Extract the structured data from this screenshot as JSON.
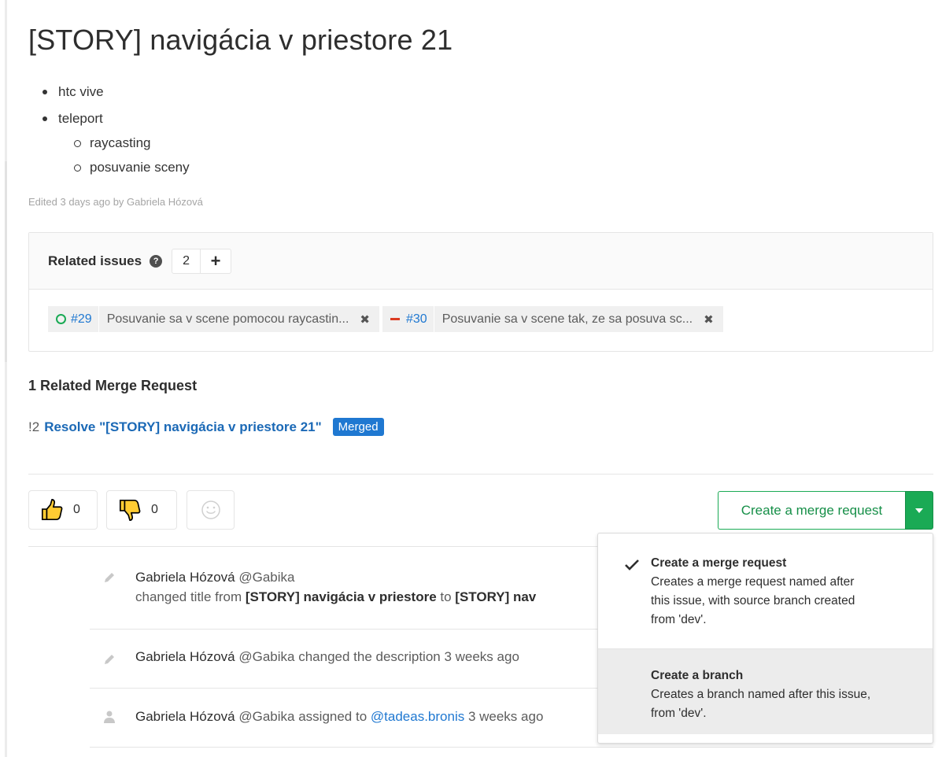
{
  "issue": {
    "title": "[STORY] navigácia v priestore 21",
    "description": {
      "items": [
        "htc vive",
        "teleport"
      ],
      "subitems": [
        "raycasting",
        "posuvanie sceny"
      ]
    },
    "edited_text": "Edited 3 days ago by Gabriela Hózová"
  },
  "related_issues": {
    "title": "Related issues",
    "count": "2",
    "add_label": "+",
    "items": [
      {
        "status": "open",
        "ref": "#29",
        "title": "Posuvanie sa v scene pomocou raycastin...",
        "remove": "✖"
      },
      {
        "status": "closed",
        "ref": "#30",
        "title": "Posuvanie sa v scene tak, ze sa posuva sc...",
        "remove": "✖"
      }
    ]
  },
  "merge_requests": {
    "heading": "1 Related Merge Request",
    "items": [
      {
        "id": "!2",
        "title": "Resolve \"[STORY] navigácia v priestore 21\"",
        "status": "Merged"
      }
    ]
  },
  "awards": {
    "thumbs_up": "0",
    "thumbs_down": "0"
  },
  "create_mr": {
    "label": "Create a merge request",
    "options": [
      {
        "title": "Create a merge request",
        "desc_lines": [
          "Creates a merge request named after",
          "this issue, with source branch created",
          "from 'dev'."
        ],
        "selected": true
      },
      {
        "title": "Create a branch",
        "desc_lines": [
          "Creates a branch named after this issue,",
          "from 'dev'."
        ],
        "selected": false
      }
    ]
  },
  "timeline": [
    {
      "icon": "pencil-icon",
      "author": "Gabriela Hózová",
      "username": "@Gabika",
      "line2_prefix": "changed title from ",
      "old_title": "[STORY] navigácia v priestore",
      "line2_mid": " to ",
      "new_title_visible": "[STORY] nav"
    },
    {
      "icon": "pencil-icon",
      "author": "Gabriela Hózová",
      "username": "@Gabika",
      "action": " changed the description 3 weeks ago"
    },
    {
      "icon": "user-icon",
      "author": "Gabriela Hózová",
      "username": "@Gabika",
      "action": " assigned to ",
      "link": "@tadeas.bronis",
      "time": " 3 weeks ago"
    }
  ],
  "colors": {
    "green": "#1aaa55",
    "blue": "#1f78d1",
    "red": "#db3b21"
  }
}
